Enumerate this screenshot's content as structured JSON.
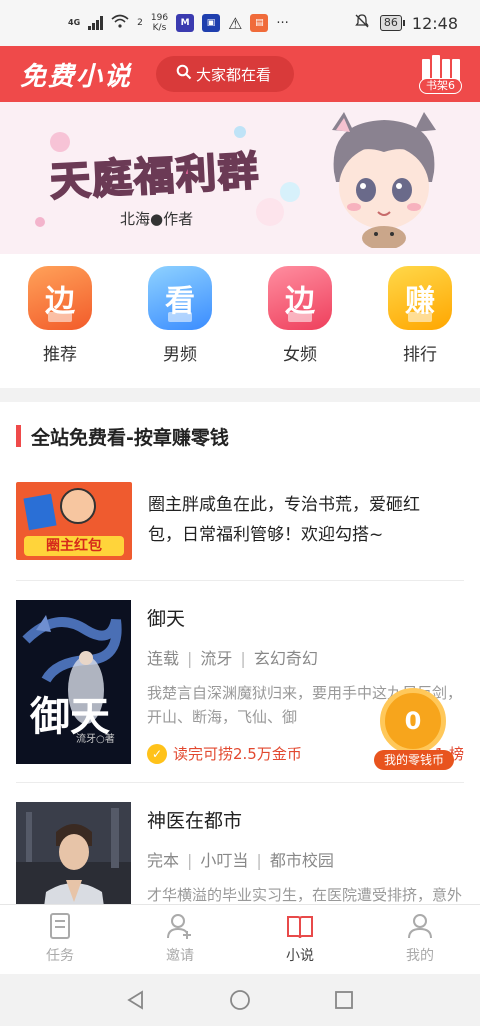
{
  "status_bar": {
    "network": "4G",
    "wifi_level": "2",
    "speed_value": "196",
    "speed_unit": "K/s",
    "battery": "86",
    "time": "12:48"
  },
  "header": {
    "logo": "免费小说",
    "search_placeholder": "大家都在看",
    "shelf_label": "书架6",
    "brand_color": "#ef4a4a"
  },
  "banner": {
    "title": "天庭福利群",
    "subtitle": "北海●作者"
  },
  "categories": [
    {
      "glyph": "边",
      "label": "推荐",
      "color": "#f57a3c"
    },
    {
      "glyph": "看",
      "label": "男频",
      "color": "#4aa8ff"
    },
    {
      "glyph": "边",
      "label": "女频",
      "color": "#f2566c"
    },
    {
      "glyph": "赚",
      "label": "排行",
      "color": "#ffb300"
    }
  ],
  "section": {
    "title": "全站免费看-按章赚零钱"
  },
  "promo": {
    "tag": "圈主红包",
    "text": "圈主胖咸鱼在此，专治书荒，爱砸红包，日常福利管够！欢迎勾搭~"
  },
  "books": [
    {
      "cover_text": "御天",
      "cover_author": "流牙○著",
      "title": "御天",
      "status": "连载",
      "author": "流牙",
      "genre": "玄幻奇幻",
      "desc": "我楚言自深渊魔狱归来，要用手中这九尺巨剑，开山、断海，飞仙、御",
      "reward": "读完可捞2.5万金币",
      "rank": "1 榜"
    },
    {
      "title": "神医在都市",
      "status": "完本",
      "author": "小叮当",
      "genre": "都市校园",
      "desc": "才华横溢的毕业实习生，在医院遭受排挤，意外获得一本上古医术，一步"
    }
  ],
  "floating_coin": {
    "value": "0",
    "label": "我的零钱币"
  },
  "tabs": [
    {
      "label": "任务",
      "icon": "task-icon"
    },
    {
      "label": "邀请",
      "icon": "invite-icon"
    },
    {
      "label": "小说",
      "icon": "book-icon",
      "active": true
    },
    {
      "label": "我的",
      "icon": "profile-icon"
    }
  ]
}
